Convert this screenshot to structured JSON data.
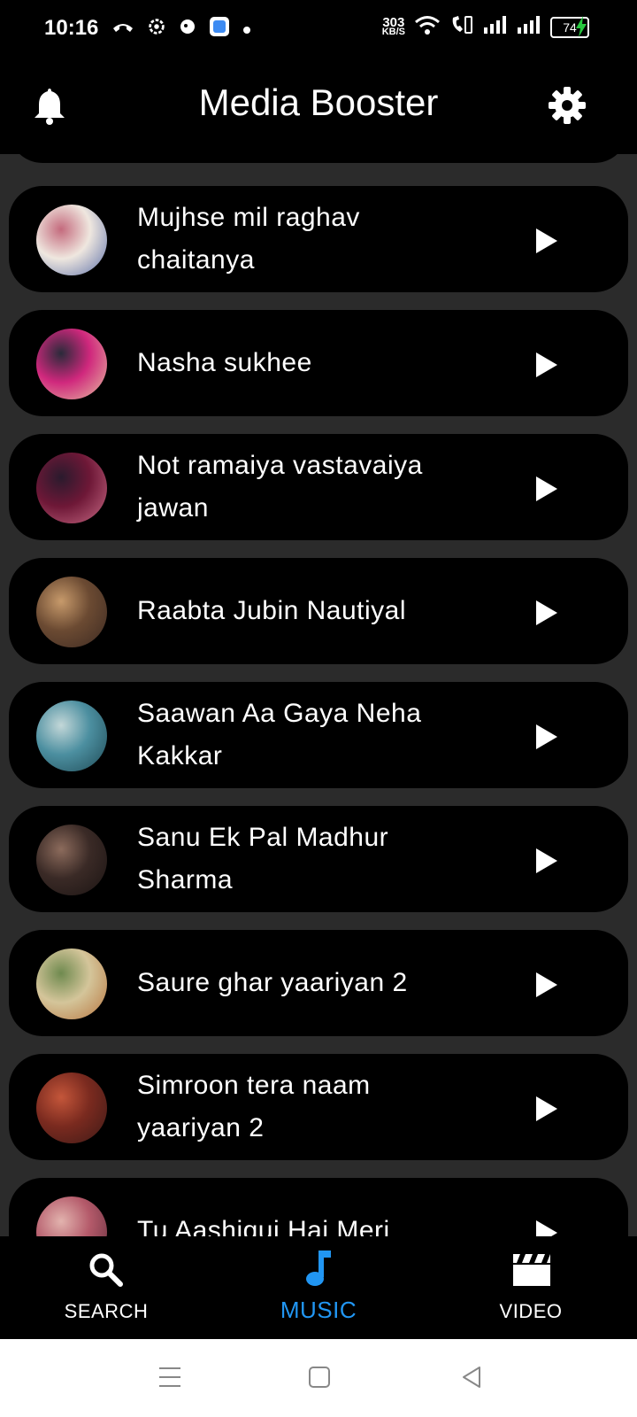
{
  "status_bar": {
    "time": "10:16",
    "speed_value": "303",
    "speed_unit": "KB/S",
    "battery": "74"
  },
  "app_bar": {
    "title": "Media Booster",
    "left_icon": "bell-icon",
    "right_icon": "gear-icon"
  },
  "songs": [
    {
      "title": "Mujhse mil raghav chaitanya",
      "colors": [
        "#efe7df",
        "#c46a7d",
        "#5b6fa8"
      ]
    },
    {
      "title": "Nasha sukhee",
      "colors": [
        "#d0287d",
        "#2a2a3a",
        "#e6c1a0"
      ]
    },
    {
      "title": "Not ramaiya vastavaiya jawan",
      "colors": [
        "#6e1837",
        "#2a1a2d",
        "#c86a85"
      ]
    },
    {
      "title": "Raabta Jubin Nautiyal",
      "colors": [
        "#6b4a32",
        "#c79a6b",
        "#3c2a22"
      ]
    },
    {
      "title": "Saawan Aa Gaya Neha Kakkar",
      "colors": [
        "#4c8fa0",
        "#c3d7d8",
        "#1f4a55"
      ]
    },
    {
      "title": "Sanu Ek Pal Madhur Sharma",
      "colors": [
        "#3a2a26",
        "#8c6b5c",
        "#1b1413"
      ]
    },
    {
      "title": "Saure ghar yaariyan 2",
      "colors": [
        "#d4c59a",
        "#6f8a4f",
        "#b8753f"
      ]
    },
    {
      "title": "Simroon tera naam yaariyan 2",
      "colors": [
        "#7a2a1f",
        "#c4563a",
        "#3d1a17"
      ]
    },
    {
      "title": "Tu Aashiqui Hai Meri",
      "colors": [
        "#b45a6a",
        "#e2b3ae",
        "#5d2b3a"
      ]
    }
  ],
  "bottom_nav": [
    {
      "label": "SEARCH",
      "icon": "search-icon",
      "active": false
    },
    {
      "label": "MUSIC",
      "icon": "music-note-icon",
      "active": true
    },
    {
      "label": "VIDEO",
      "icon": "clapperboard-icon",
      "active": false
    }
  ],
  "colors": {
    "active_tab": "#2196f3",
    "card_bg": "#000000",
    "list_bg": "#2b2b2b",
    "charging": "#27c93f"
  }
}
